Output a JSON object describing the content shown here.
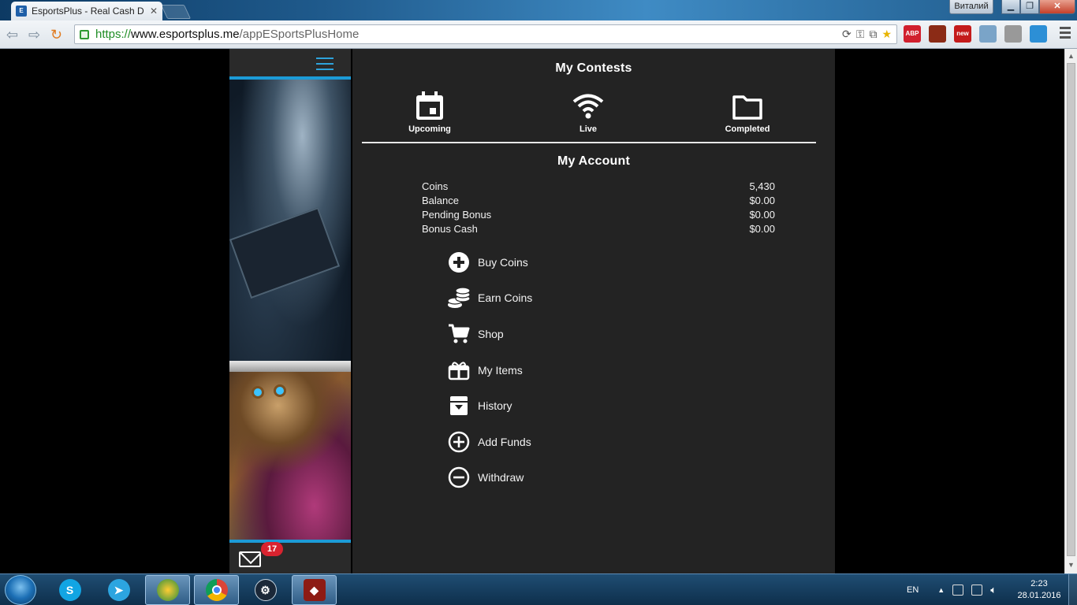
{
  "window": {
    "tab_title": "EsportsPlus - Real Cash D",
    "tab_close": "✕",
    "profile_name": "Виталий",
    "minimize": "▁",
    "maximize": "❐",
    "close": "✕"
  },
  "toolbar": {
    "url_scheme": "https://",
    "url_host": "www.esportsplus.me",
    "url_path": "/appESportsPlusHome",
    "back": "⇦",
    "forward": "⇨",
    "reload": "↻"
  },
  "extensions": [
    {
      "name": "adblock-plus-icon",
      "label": "ABP",
      "color": "#d1202e"
    },
    {
      "name": "extension-1-icon",
      "label": "",
      "color": "#8b2b16"
    },
    {
      "name": "extension-new-icon",
      "label": "new",
      "color": "#c41b1b"
    },
    {
      "name": "extension-2-icon",
      "label": "",
      "color": "#7aa4c8"
    },
    {
      "name": "extension-3-icon",
      "label": "",
      "color": "#999999"
    },
    {
      "name": "extension-4-icon",
      "label": "",
      "color": "#2c8fd6"
    }
  ],
  "sidebar": {
    "mail_count": "17"
  },
  "contests": {
    "title": "My Contests",
    "tabs": [
      {
        "label": "Upcoming",
        "icon": "calendar-icon"
      },
      {
        "label": "Live",
        "icon": "wifi-icon"
      },
      {
        "label": "Completed",
        "icon": "folder-icon"
      }
    ]
  },
  "account": {
    "title": "My Account",
    "rows": [
      {
        "label": "Coins",
        "value": "5,430"
      },
      {
        "label": "Balance",
        "value": "$0.00"
      },
      {
        "label": "Pending Bonus",
        "value": "$0.00"
      },
      {
        "label": "Bonus Cash",
        "value": "$0.00"
      }
    ]
  },
  "menu": [
    {
      "label": "Buy Coins",
      "icon": "plus-circle-filled-icon"
    },
    {
      "label": "Earn Coins",
      "icon": "coins-stack-icon"
    },
    {
      "label": "Shop",
      "icon": "cart-icon"
    },
    {
      "label": "My Items",
      "icon": "gift-box-icon"
    },
    {
      "label": "History",
      "icon": "archive-box-icon"
    },
    {
      "label": "Add Funds",
      "icon": "plus-circle-outline-icon"
    },
    {
      "label": "Withdraw",
      "icon": "minus-circle-outline-icon"
    }
  ],
  "taskbar": {
    "language": "EN",
    "time": "2:23",
    "date": "28.01.2016"
  },
  "colors": {
    "accent": "#1c9bd7",
    "panel": "#232323",
    "badge": "#d8232f"
  }
}
